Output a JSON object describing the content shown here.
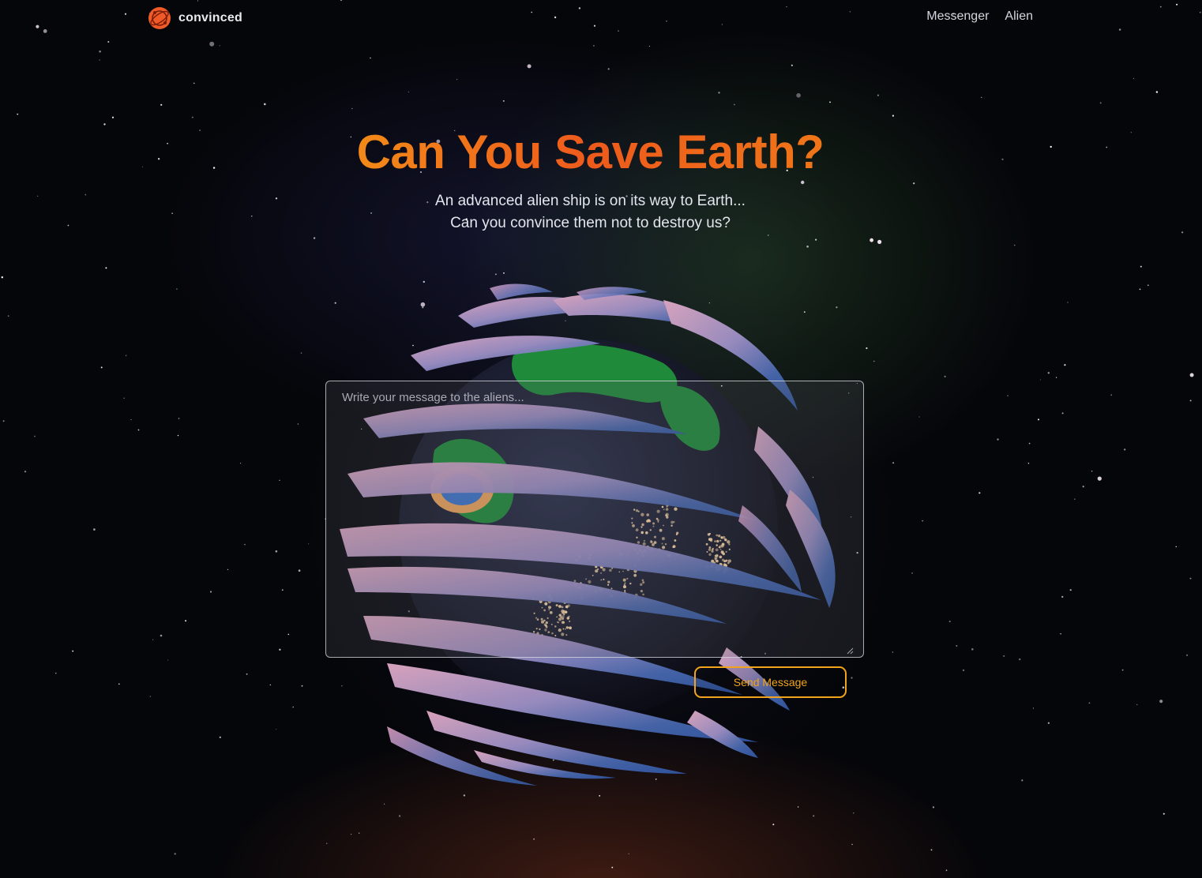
{
  "header": {
    "brand_name": "convinced",
    "brand_icon": "orbit-globe-icon",
    "nav": [
      {
        "label": "Messenger"
      },
      {
        "label": "Alien"
      }
    ]
  },
  "hero": {
    "title": "Can You Save Earth?",
    "subtitle_line1": "An advanced alien ship is on its way to Earth...",
    "subtitle_line2": "Can you convince them not to destroy us?"
  },
  "message_form": {
    "placeholder": "Write your message to the aliens...",
    "value": "",
    "send_label": "Send Message"
  },
  "colors": {
    "accent": "#f2a41c",
    "title_gradient": [
      "#f5a214",
      "#ee5a1c",
      "#f3a61a"
    ],
    "background": "#05060a",
    "cloud_pink": "#d8a0bc",
    "cloud_blue": "#3d62a8",
    "planet_ocean": "#1d2235",
    "planet_land": "#1f8a3a"
  }
}
